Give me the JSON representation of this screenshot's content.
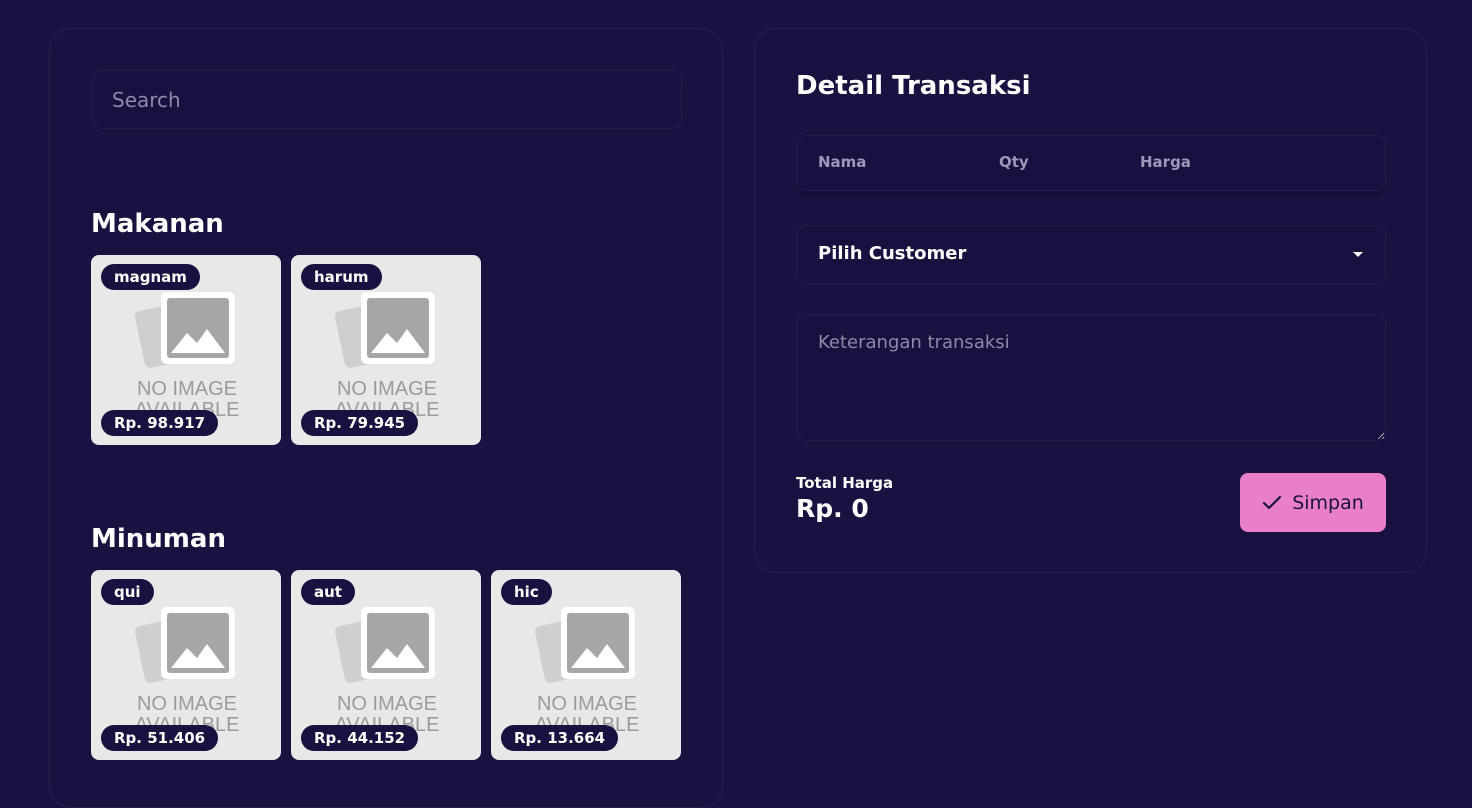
{
  "search": {
    "placeholder": "Search"
  },
  "categories": [
    {
      "title": "Makanan",
      "products": [
        {
          "name": "magnam",
          "price": "Rp. 98.917",
          "image_text": [
            "NO IMAGE",
            "AVAILABLE"
          ]
        },
        {
          "name": "harum",
          "price": "Rp. 79.945",
          "image_text": [
            "NO IMAGE",
            "AVAILABLE"
          ]
        }
      ]
    },
    {
      "title": "Minuman",
      "products": [
        {
          "name": "qui",
          "price": "Rp. 51.406",
          "image_text": [
            "NO IMAGE",
            "AVAILABLE"
          ]
        },
        {
          "name": "aut",
          "price": "Rp. 44.152",
          "image_text": [
            "NO IMAGE",
            "AVAILABLE"
          ]
        },
        {
          "name": "hic",
          "price": "Rp. 13.664",
          "image_text": [
            "NO IMAGE",
            "AVAILABLE"
          ]
        }
      ]
    }
  ],
  "detail": {
    "title": "Detail Transaksi",
    "columns": [
      "Nama",
      "Qty",
      "Harga"
    ],
    "customer_select": "Pilih Customer",
    "notes_placeholder": "Keterangan transaksi",
    "total_label": "Total Harga",
    "total_value": "Rp. 0",
    "save_label": "Simpan"
  },
  "colors": {
    "background": "#1b1140",
    "accent": "#e97fcb",
    "card": "#e8e8e8"
  }
}
